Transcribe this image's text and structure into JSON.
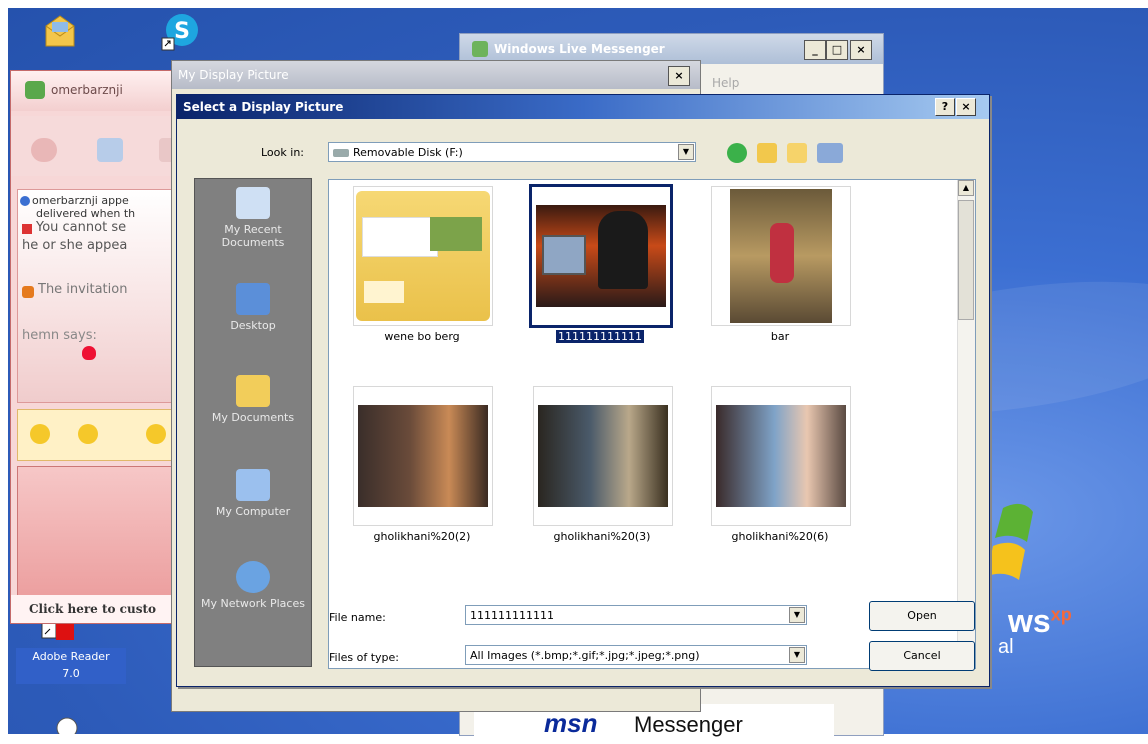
{
  "desktop": {
    "icons": [
      {
        "label": "",
        "icon": "folder-mail-icon"
      },
      {
        "label": "",
        "icon": "skype-icon"
      }
    ],
    "adobe": {
      "label_line1": "Adobe Reader",
      "label_line2": "7.0"
    },
    "xp_brand": {
      "text": "ws",
      "sup": "xp",
      "sub": "al"
    }
  },
  "chat_window": {
    "contact": "omerbarznji",
    "lines": [
      "omerbarznji appe",
      "delivered when th",
      "You cannot se",
      "he or she appea",
      "The invitation",
      "hemn says:"
    ],
    "bottom_link": "Click here to custo"
  },
  "messenger_window": {
    "title": "Windows Live Messenger",
    "menu_item": "Help",
    "banner_brand": "msn",
    "banner_text": "Messenger"
  },
  "my_display_picture": {
    "title": "My Display Picture"
  },
  "dialog": {
    "title": "Select a Display Picture",
    "help_button": "?",
    "close_button": "×",
    "look_in_label": "Look in:",
    "look_in_value": "Removable Disk (F:)",
    "places": [
      {
        "label": "My Recent Documents",
        "icon": "recent-documents-icon"
      },
      {
        "label": "Desktop",
        "icon": "desktop-icon"
      },
      {
        "label": "My Documents",
        "icon": "my-documents-icon"
      },
      {
        "label": "My Computer",
        "icon": "my-computer-icon"
      },
      {
        "label": "My Network Places",
        "icon": "network-places-icon"
      }
    ],
    "files": [
      {
        "name": "wene bo berg",
        "kind": "folder"
      },
      {
        "name": "111111111111",
        "kind": "image",
        "selected": true
      },
      {
        "name": "bar",
        "kind": "image"
      },
      {
        "name": "gholikhani%20(2)",
        "kind": "image"
      },
      {
        "name": "gholikhani%20(3)",
        "kind": "image"
      },
      {
        "name": "gholikhani%20(6)",
        "kind": "image"
      }
    ],
    "file_name_label": "File name:",
    "file_name_value": "111111111111",
    "files_type_label": "Files of type:",
    "files_type_value": "All Images (*.bmp;*.gif;*.jpg;*.jpeg;*.png)",
    "open_button": "Open",
    "cancel_button": "Cancel"
  }
}
